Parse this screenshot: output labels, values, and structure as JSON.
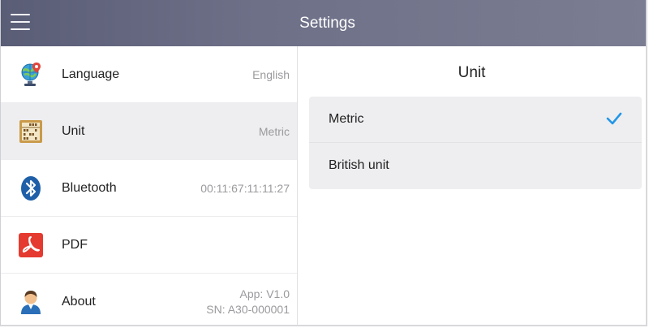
{
  "header": {
    "title": "Settings"
  },
  "sidebar": {
    "items": [
      {
        "label": "Language",
        "value": "English",
        "icon": "globe-icon"
      },
      {
        "label": "Unit",
        "value": "Metric",
        "icon": "abacus-icon",
        "active": true
      },
      {
        "label": "Bluetooth",
        "value": "00:11:67:11:11:27",
        "icon": "bluetooth-icon"
      },
      {
        "label": "PDF",
        "value": "",
        "icon": "pdf-icon"
      },
      {
        "label": "About",
        "value_line1": "App: V1.0",
        "value_line2": "SN: A30-000001",
        "icon": "user-icon"
      }
    ]
  },
  "panel": {
    "title": "Unit",
    "options": [
      {
        "label": "Metric",
        "selected": true
      },
      {
        "label": "British unit",
        "selected": false
      }
    ]
  },
  "colors": {
    "header_bg": "#6e7088",
    "active_item_bg": "#eeeef0",
    "check_color": "#2196e8",
    "bluetooth_blue": "#1f5fa8",
    "pdf_red": "#e53a2f"
  }
}
